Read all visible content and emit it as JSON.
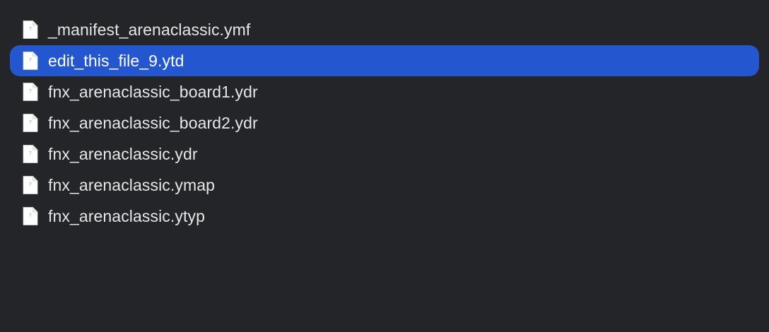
{
  "file_list": {
    "selected_index": 1,
    "icon": "document-icon",
    "items": [
      {
        "name": "_manifest_arenaclassic.ymf"
      },
      {
        "name": "edit_this_file_9.ytd"
      },
      {
        "name": "fnx_arenaclassic_board1.ydr"
      },
      {
        "name": "fnx_arenaclassic_board2.ydr"
      },
      {
        "name": "fnx_arenaclassic.ydr"
      },
      {
        "name": "fnx_arenaclassic.ymap"
      },
      {
        "name": "fnx_arenaclassic.ytyp"
      }
    ]
  },
  "colors": {
    "background": "#242528",
    "selection": "#2457cf",
    "text": "#e6e6e7",
    "selected_text": "#ffffff"
  }
}
